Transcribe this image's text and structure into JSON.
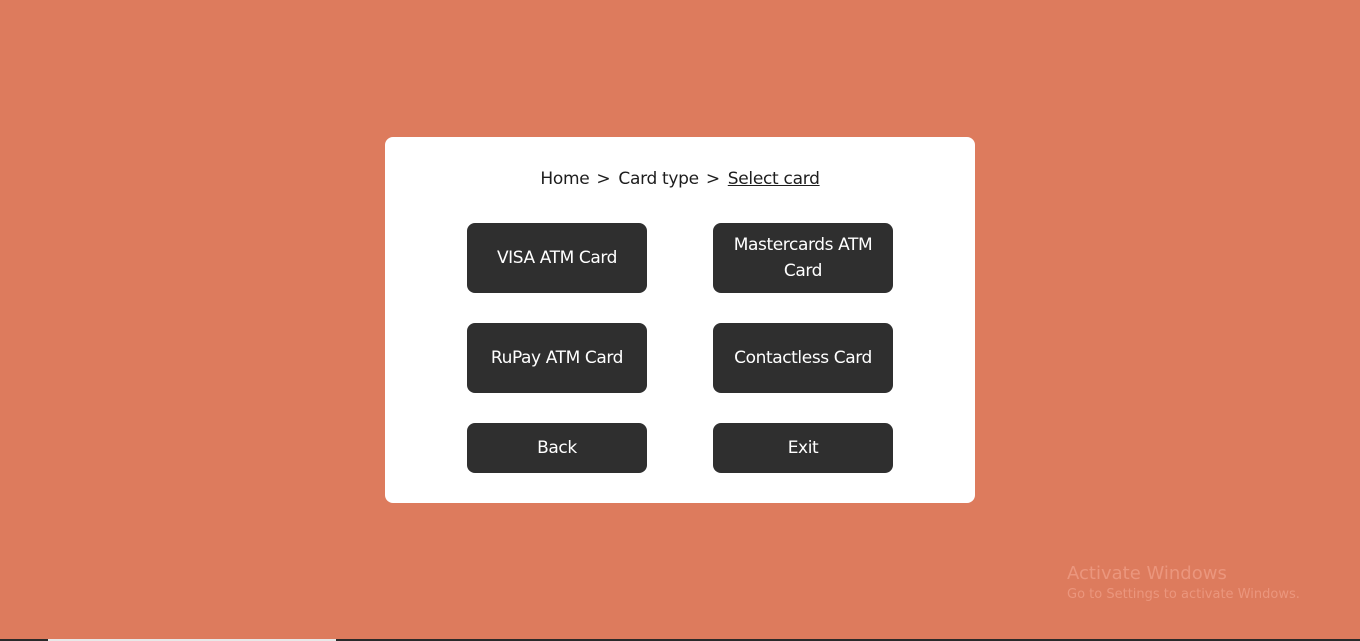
{
  "breadcrumb": {
    "home": "Home",
    "card_type": "Card type",
    "current": "Select card",
    "separator": ">"
  },
  "buttons": {
    "visa": "VISA ATM Card",
    "mastercard": "Mastercards ATM Card",
    "rupay": "RuPay ATM Card",
    "contactless": "Contactless Card",
    "back": "Back",
    "exit": "Exit"
  },
  "watermark": {
    "title": "Activate Windows",
    "subtitle": "Go to Settings to activate Windows."
  },
  "colors": {
    "background": "#dd7b5d",
    "panel": "#ffffff",
    "button": "#2f2f2f",
    "button_text": "#ffffff"
  }
}
